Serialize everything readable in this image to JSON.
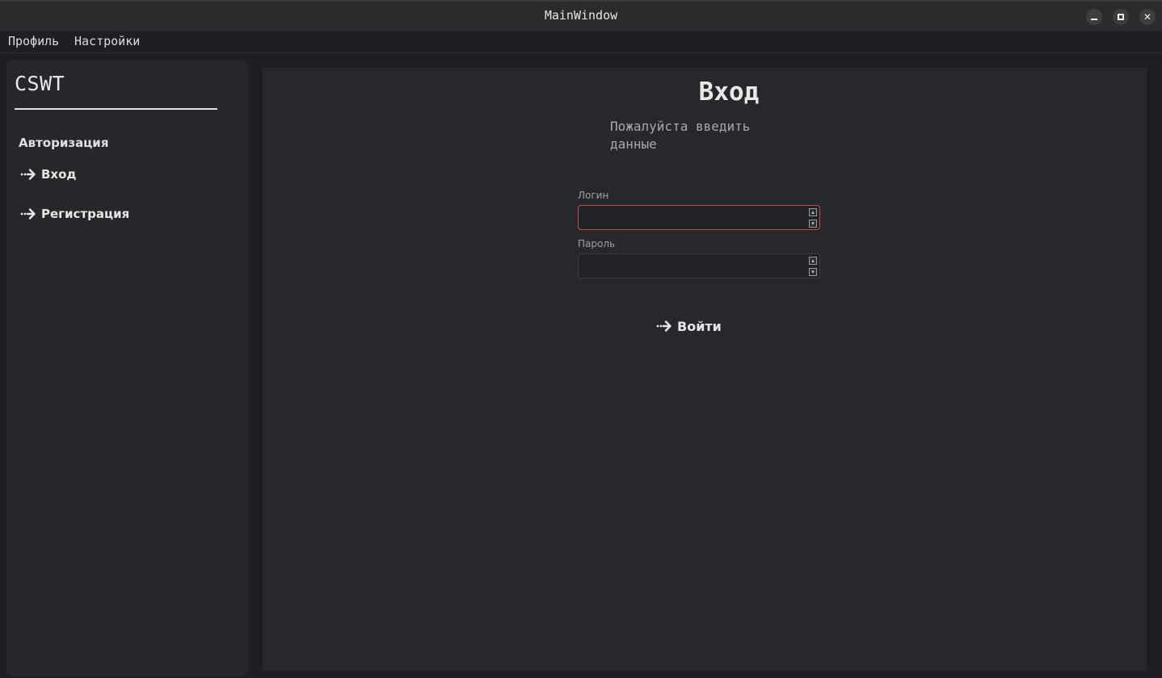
{
  "window": {
    "title": "MainWindow"
  },
  "menu": {
    "profile": "Профиль",
    "settings": "Настройки"
  },
  "sidebar": {
    "brand": "CSWT",
    "section": "Авторизация",
    "items": [
      {
        "label": "Вход",
        "icon": "arrow-right-dots-icon"
      },
      {
        "label": "Регистрация",
        "icon": "arrow-right-dots-icon"
      }
    ]
  },
  "main": {
    "title": "Вход",
    "subtitle_line1": "Пожалуйста введить",
    "subtitle_line2": "данные",
    "login_label": "Логин",
    "login_value": "",
    "password_label": "Пароль",
    "password_value": "",
    "submit_label": "Войти"
  },
  "colors": {
    "background": "#1e1f22",
    "panel": "#27282b",
    "sidebar": "#26272a",
    "error_border": "#c94a4a"
  }
}
